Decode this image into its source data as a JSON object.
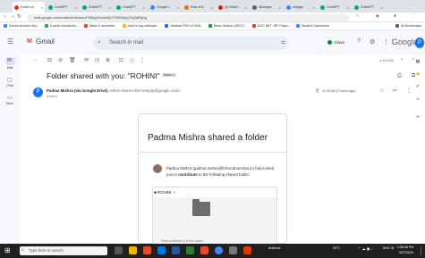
{
  "browser": {
    "tabs": [
      {
        "label": "Folder sh",
        "color": "#d93025"
      },
      {
        "label": "ChatGPT",
        "color": "#10a37f"
      },
      {
        "label": "ChatGPT",
        "color": "#10a37f"
      },
      {
        "label": "ChatGPT",
        "color": "#10a37f"
      },
      {
        "label": "Google L",
        "color": "#4285f4"
      },
      {
        "label": "Role of A",
        "color": "#e8710a"
      },
      {
        "label": "(3) What i",
        "color": "#b92b27"
      },
      {
        "label": "dikategor",
        "color": "#5f6368"
      },
      {
        "label": "chatgpt",
        "color": "#4285f4"
      },
      {
        "label": "ChatGPT",
        "color": "#10a37f"
      },
      {
        "label": "ChatGPT",
        "color": "#10a37f"
      }
    ],
    "url": "mail.google.com/mail/u/0/#inbox/FMfcgzGwJsNjXTWMWpgTbpjWfQpg",
    "bookmarks": [
      "Solved Answer Key...",
      "A quick introductio...",
      "What is Immediat...",
      "what is any software...",
      "Vedanta PDFs EXAB...",
      "Basic Search (OECD...",
      "UGC NET JRF Paper...",
      "Student Dashboard",
      "All Bookmarks"
    ]
  },
  "gmail": {
    "brand": "Gmail",
    "search_placeholder": "Search in mail",
    "status": "Active",
    "rail": {
      "mail": "Mail",
      "chat": "Chat",
      "meet": "Meet"
    },
    "pager": "4 of 9,045",
    "subject": "Folder shared with you: \"ROHINI\"",
    "chip": "Inbox ×",
    "sender_name": "Padma Mishra (via Google Drive)",
    "sender_email": "<drive-shares-dm-noreply@google.com>",
    "to": "to me ▾",
    "timestamp": "11:06 AM (2 hours ago)",
    "avatar_letter": "P"
  },
  "card": {
    "title": "Padma Mishra shared a folder",
    "message_part1": "Padma Mishra (padma.mishra@bmscdmumbai.in) has invited you to ",
    "message_bold": "contribute",
    "message_part2": " to the following shared folder:",
    "folder_name": "ROHINI",
    "footer": "Padma Mishra is in the owner"
  },
  "taskbar": {
    "search_placeholder": "Type here to search",
    "stock": "Antitrust",
    "weather": "32°C",
    "lang": "ENG IN",
    "time": "1:56:36 PM",
    "date": "5/27/2024"
  }
}
